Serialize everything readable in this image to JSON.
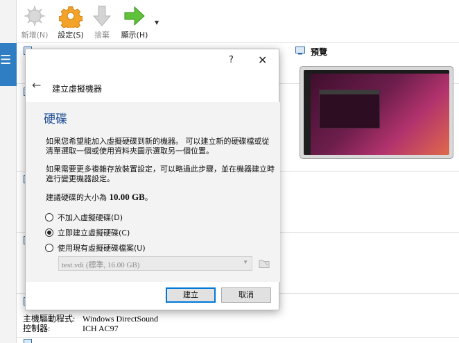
{
  "toolbar": {
    "new_label": "新增(N)",
    "settings_label": "設定(S)",
    "discard_label": "捨棄",
    "show_label": "顯示(H)"
  },
  "main": {
    "preview_title": "預覽",
    "audio_driver_label": "主機驅動程式:",
    "audio_driver_value": "Windows DirectSound",
    "controller_label": "控制器:",
    "controller_value": "ICH AC97"
  },
  "dialog": {
    "help_label": "?",
    "close_label": "✕",
    "wizard_title": "建立虛擬機器",
    "section_title": "硬碟",
    "paragraph1": "如果您希望能加入虛擬硬碟到新的機器。 可以建立新的硬碟檔或從清單選取一個或使用資料夾圖示選取另一個位置。",
    "paragraph2": "如果需要更多複雜存放裝置設定，可以略過此步驟，並在機器建立時進行變更機器設定。",
    "size_prefix": "建議硬碟的大小為 ",
    "size_value": "10.00 GB",
    "size_suffix": "。",
    "options": [
      {
        "label": "不加入虛擬硬碟(D)",
        "selected": false
      },
      {
        "label": "立即建立虛擬硬碟(C)",
        "selected": true
      },
      {
        "label": "使用現有虛擬硬碟檔案(U)",
        "selected": false
      }
    ],
    "existing_file": "test.vdi (標準, 16.00 GB)",
    "create_button": "建立",
    "cancel_button": "取消"
  },
  "colors": {
    "accent": "#1f4e97",
    "selection": "#2f7ec3",
    "primary_border": "#0078d7"
  }
}
